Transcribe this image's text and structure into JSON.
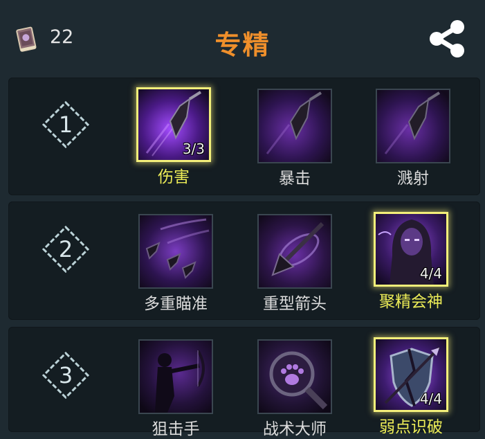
{
  "header": {
    "points": "22",
    "title": "专精"
  },
  "tiers": [
    {
      "number": "1",
      "skills": [
        {
          "name": "伤害",
          "level": "3/3",
          "selected": true,
          "icon": "arrowhead-icon"
        },
        {
          "name": "暴击",
          "level": "",
          "selected": false,
          "icon": "arrowhead-icon"
        },
        {
          "name": "溅射",
          "level": "",
          "selected": false,
          "icon": "arrowhead-icon"
        }
      ]
    },
    {
      "number": "2",
      "skills": [
        {
          "name": "多重瞄准",
          "level": "",
          "selected": false,
          "icon": "multishot-icon"
        },
        {
          "name": "重型箭头",
          "level": "",
          "selected": false,
          "icon": "heavy-arrow-icon"
        },
        {
          "name": "聚精会神",
          "level": "4/4",
          "selected": true,
          "icon": "focus-hood-icon"
        }
      ]
    },
    {
      "number": "3",
      "skills": [
        {
          "name": "狙击手",
          "level": "",
          "selected": false,
          "icon": "sniper-icon"
        },
        {
          "name": "战术大师",
          "level": "",
          "selected": false,
          "icon": "paw-magnifier-icon"
        },
        {
          "name": "弱点识破",
          "level": "4/4",
          "selected": true,
          "icon": "broken-shield-icon"
        }
      ]
    }
  ],
  "colors": {
    "background": "#1e2a31",
    "panel": "#141d22",
    "title": "#ef8f2b",
    "selected_border": "#f3ef7a",
    "selected_name": "#ecec57"
  }
}
